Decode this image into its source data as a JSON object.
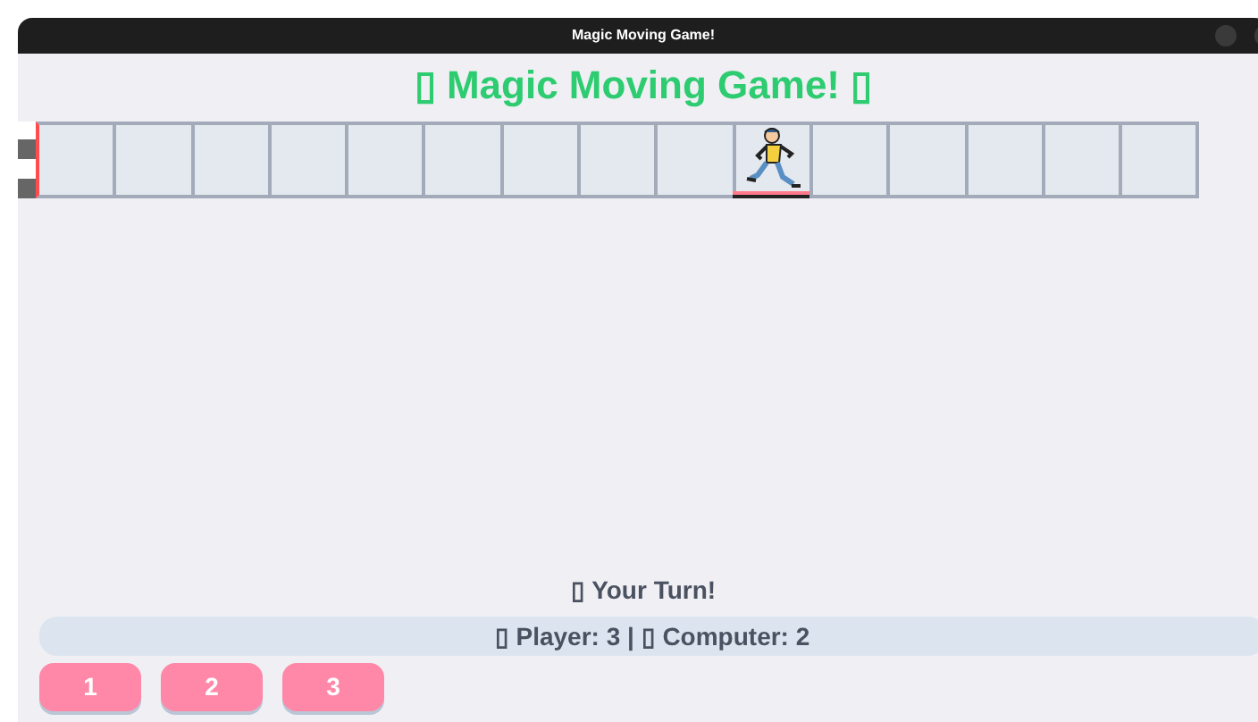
{
  "window": {
    "title": "Magic Moving Game!"
  },
  "heading": "▯ Magic Moving Game! ▯",
  "board": {
    "cells": [
      {
        "occupied": false
      },
      {
        "occupied": false
      },
      {
        "occupied": false
      },
      {
        "occupied": false
      },
      {
        "occupied": false
      },
      {
        "occupied": false
      },
      {
        "occupied": false
      },
      {
        "occupied": false
      },
      {
        "occupied": false
      },
      {
        "occupied": true
      },
      {
        "occupied": false
      },
      {
        "occupied": false
      },
      {
        "occupied": false
      },
      {
        "occupied": false
      },
      {
        "occupied": false
      }
    ]
  },
  "turn": "▯ Your Turn!",
  "score": "▯ Player: 3 | ▯ Computer: 2",
  "buttons": [
    "1",
    "2",
    "3"
  ]
}
